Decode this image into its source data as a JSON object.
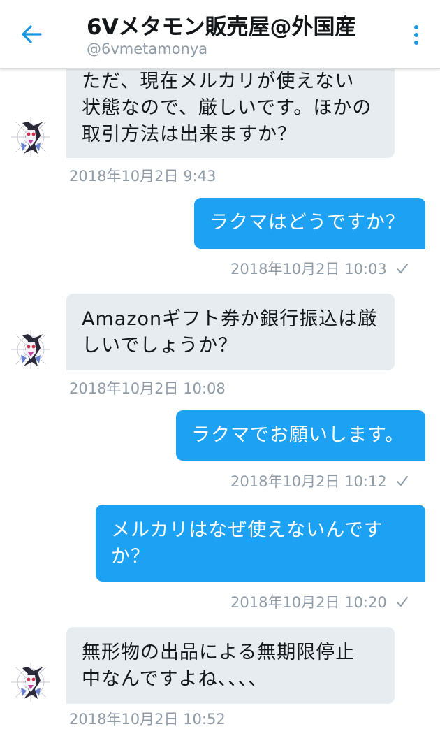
{
  "header": {
    "title": "6Vメタモン販売屋@外国産",
    "handle": "@6vmetamonya",
    "back_icon": "arrow-left-icon",
    "more_icon": "more-vertical-icon",
    "accent_color": "#1b95e0"
  },
  "messages": [
    {
      "direction": "received",
      "lines": [
        "ただ、現在メルカリが使えない",
        "状態なので、厳しいです。ほかの",
        "取引方法は出来ますか？"
      ],
      "timestamp": "2018年10月2日 9:43"
    },
    {
      "direction": "sent",
      "lines": [
        "ラクマはどうですか？"
      ],
      "timestamp": "2018年10月2日 10:03"
    },
    {
      "direction": "received",
      "lines": [
        "Amazonギフト券か銀行振込は厳",
        "しいでしょうか？"
      ],
      "timestamp": "2018年10月2日 10:08"
    },
    {
      "direction": "sent",
      "lines": [
        "ラクマでお願いします。"
      ],
      "timestamp": "2018年10月2日 10:12"
    },
    {
      "direction": "sent",
      "lines": [
        "メルカリはなぜ使えないんです",
        "か？"
      ],
      "timestamp": "2018年10月2日 10:20"
    },
    {
      "direction": "received",
      "lines": [
        "無形物の出品による無期限停止",
        "中なんですよね、、、、"
      ],
      "timestamp": "2018年10月2日 10:52"
    }
  ],
  "colors": {
    "sent_bubble": "#1da1f2",
    "received_bubble": "#e6ecf0",
    "timestamp": "#8f9ba6"
  }
}
